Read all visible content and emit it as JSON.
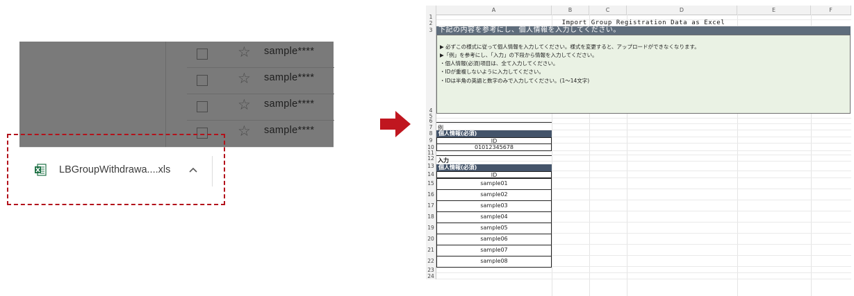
{
  "browser": {
    "mail_rows": [
      {
        "sender": "sample****"
      },
      {
        "sender": "sample****"
      },
      {
        "sender": "sample****"
      },
      {
        "sender": "sample****"
      }
    ],
    "download": {
      "file_name": "LBGroupWithdrawa....xls",
      "icon": "excel-file-icon",
      "chevron": "chevron-up-icon"
    },
    "highlight_color": "#b3121b"
  },
  "arrow": {
    "icon": "arrow-right-icon",
    "color": "#c0161f"
  },
  "sheet": {
    "columns": [
      "A",
      "B",
      "C",
      "D",
      "E",
      "F"
    ],
    "rows": [
      "1",
      "2",
      "3",
      "4",
      "5",
      "6",
      "7",
      "8",
      "9",
      "10",
      "11",
      "12",
      "13",
      "14",
      "15",
      "16",
      "17",
      "18",
      "19",
      "20",
      "21",
      "22",
      "23",
      "24"
    ],
    "title": "Import Group Registration Data as Excel",
    "banner": "下記の内容を参考にし、個人情報を入力してください。",
    "instructions": [
      "▶ 必ずこの様式に従って個人情報を入力してください。様式を変更すると、アップロードができなくなります。",
      "▶「例」を参考にし、「入力」の下段から情報を入力してください。",
      "・個人情報(必須)項目は、全て入力してください。",
      "・IDが重複しないように入力してください。",
      "・IDは半角の英語と数字のみで入力してください。(1〜14文字)"
    ],
    "example": {
      "label": "例",
      "header": "個人情報(必須)",
      "col": "ID",
      "value": "01012345678"
    },
    "input": {
      "label": "入力",
      "header": "個人情報(必須)",
      "col": "ID",
      "values": [
        "sample01",
        "sample02",
        "sample03",
        "sample04",
        "sample05",
        "sample06",
        "sample07",
        "sample08"
      ]
    },
    "colors": {
      "banner": "#5f6d7c",
      "section_header": "#44546a",
      "instruction_bg": "#eaf2e4"
    }
  }
}
